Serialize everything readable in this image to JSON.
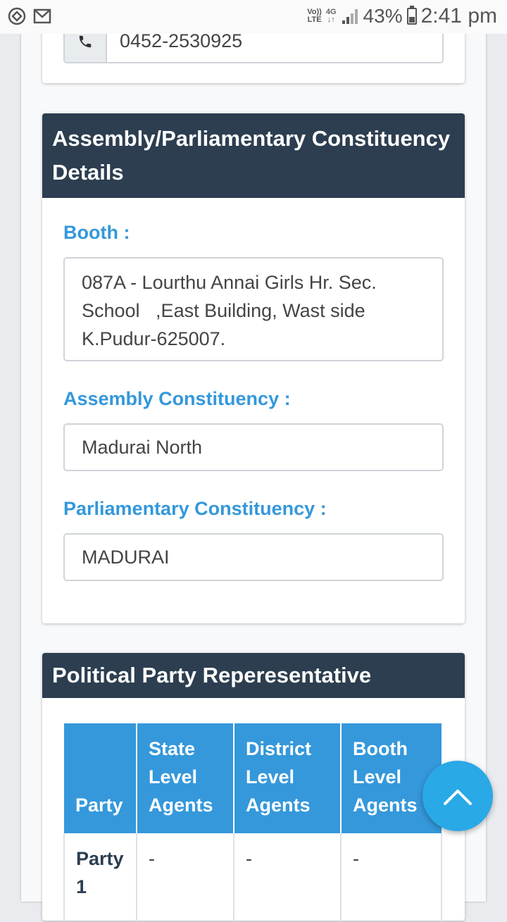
{
  "status_bar": {
    "volte_top": "Vo))",
    "volte_bottom": "LTE",
    "network": "4G",
    "battery_percent": "43%",
    "time": "2:41 pm",
    "battery_level": 0.43
  },
  "contact": {
    "phone": "0452-2530925",
    "phone_icon": "phone-icon"
  },
  "constituency": {
    "title": "Assembly/Parliamentary Constituency Details",
    "booth_label": "Booth :",
    "booth_value": "087A - Lourthu Annai Girls Hr. Sec. School   ,East Building, Wast side K.Pudur-625007.",
    "assembly_label": "Assembly Constituency :",
    "assembly_value": "Madurai North",
    "parliamentary_label": "Parliamentary Constituency :",
    "parliamentary_value": "MADURAI"
  },
  "party": {
    "title": "Political Party Reperesentative",
    "headers": [
      "Party",
      "State Level Agents",
      "District Level Agents",
      "Booth Level Agents"
    ],
    "rows": [
      [
        "Party 1",
        "-",
        "-",
        "-"
      ]
    ]
  },
  "colors": {
    "header_dark": "#2c3e50",
    "accent_blue": "#3498db",
    "fab_blue": "#29a9e6"
  }
}
